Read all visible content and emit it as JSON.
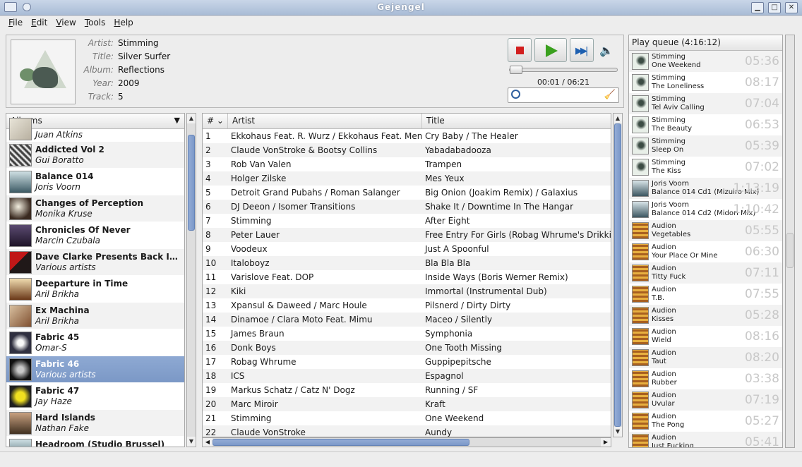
{
  "window": {
    "title": "Gejengel"
  },
  "menu": [
    "File",
    "Edit",
    "View",
    "Tools",
    "Help"
  ],
  "now_playing": {
    "labels": {
      "artist": "Artist:",
      "title": "Title:",
      "album": "Album:",
      "year": "Year:",
      "track": "Track:"
    },
    "artist": "Stimming",
    "title": "Silver Surfer",
    "album": "Reflections",
    "year": "2009",
    "track": "5",
    "time": "00:01 / 06:21",
    "progress_fraction": 0.003
  },
  "albums": {
    "header": "Albums",
    "items": [
      {
        "title": "",
        "artist": "Juan Atkins",
        "thumb": "th-drumcode",
        "partial": true
      },
      {
        "title": "Addicted Vol 2",
        "artist": "Gui Boratto",
        "thumb": "th-boratto"
      },
      {
        "title": "Balance 014",
        "artist": "Joris Voorn",
        "thumb": "th-voorn"
      },
      {
        "title": "Changes of Perception",
        "artist": "Monika Kruse",
        "thumb": "th-kruse"
      },
      {
        "title": "Chronicles Of Never",
        "artist": "Marcin Czubala",
        "thumb": "th-czubala"
      },
      {
        "title": "Dave Clarke Presents Back In T...",
        "artist": "Various artists",
        "thumb": "th-clarke"
      },
      {
        "title": "Deeparture in Time",
        "artist": "Aril Brikha",
        "thumb": "th-brikha1"
      },
      {
        "title": "Ex Machina",
        "artist": "Aril Brikha",
        "thumb": "th-brikha2"
      },
      {
        "title": "Fabric 45",
        "artist": "Omar-S",
        "thumb": "th-fab45"
      },
      {
        "title": "Fabric 46",
        "artist": "Various artists",
        "thumb": "th-fab46",
        "selected": true
      },
      {
        "title": "Fabric 47",
        "artist": "Jay Haze",
        "thumb": "th-fab47"
      },
      {
        "title": "Hard Islands",
        "artist": "Nathan Fake",
        "thumb": "th-hard"
      },
      {
        "title": "Headroom (Studio Brussel)",
        "artist": "",
        "thumb": "th-voorn"
      }
    ]
  },
  "tracks": {
    "columns": {
      "num": "#",
      "artist": "Artist",
      "title": "Title"
    },
    "rows": [
      [
        "1",
        "Ekkohaus Feat. R. Wurz / Ekkohaus Feat. Mensa",
        "Cry Baby / The Healer"
      ],
      [
        "2",
        "Claude VonStroke & Bootsy Collins",
        "Yabadabadooza"
      ],
      [
        "3",
        "Rob Van Valen",
        "Trampen"
      ],
      [
        "4",
        "Holger Zilske",
        "Mes Yeux"
      ],
      [
        "5",
        "Detroit Grand Pubahs / Roman Salanger",
        "Big Onion (Joakim Remix) / Galaxius"
      ],
      [
        "6",
        "DJ Deeon / Isomer Transitions",
        "Shake It / Downtime In The Hangar"
      ],
      [
        "7",
        "Stimming",
        "After Eight"
      ],
      [
        "8",
        "Peter Lauer",
        "Free Entry For Girls (Robag Whrume's Drikkiba"
      ],
      [
        "9",
        "Voodeux",
        "Just A Spoonful"
      ],
      [
        "10",
        "Italoboyz",
        "Bla Bla Bla"
      ],
      [
        "11",
        "Varislove Feat. DOP",
        "Inside Ways (Boris Werner Remix)"
      ],
      [
        "12",
        "Kiki",
        "Immortal (Instrumental Dub)"
      ],
      [
        "13",
        "Xpansul & Daweed / Marc Houle",
        "Pilsnerd / Dirty Dirty"
      ],
      [
        "14",
        "Dinamoe / Clara Moto Feat. Mimu",
        "Maceo / Silently"
      ],
      [
        "15",
        "James Braun",
        "Symphonia"
      ],
      [
        "16",
        "Donk Boys",
        "One Tooth Missing"
      ],
      [
        "17",
        "Robag Whrume",
        "Guppipepitsche"
      ],
      [
        "18",
        "ICS",
        "Espagnol"
      ],
      [
        "19",
        "Markus Schatz / Catz N' Dogz",
        "Running / SF"
      ],
      [
        "20",
        "Marc Miroir",
        "Kraft"
      ],
      [
        "21",
        "Stimming",
        "One Weekend"
      ],
      [
        "22",
        "Claude VonStroke",
        "Aundy"
      ]
    ]
  },
  "queue": {
    "header": "Play queue (4:16:12)",
    "items": [
      {
        "artist": "Stimming",
        "title": "One Weekend",
        "duration": "05:36",
        "thumb": "th-stim"
      },
      {
        "artist": "Stimming",
        "title": "The Loneliness",
        "duration": "08:17",
        "thumb": "th-stim"
      },
      {
        "artist": "Stimming",
        "title": "Tel Aviv Calling",
        "duration": "07:04",
        "thumb": "th-stim"
      },
      {
        "artist": "Stimming",
        "title": "The Beauty",
        "duration": "06:53",
        "thumb": "th-stim"
      },
      {
        "artist": "Stimming",
        "title": "Sleep On",
        "duration": "05:39",
        "thumb": "th-stim"
      },
      {
        "artist": "Stimming",
        "title": "The Kiss",
        "duration": "07:02",
        "thumb": "th-stim"
      },
      {
        "artist": "Joris Voorn",
        "title": "Balance 014 Cd1 (Mizuiro Mix)",
        "duration": "1:13:19",
        "thumb": "th-voornq"
      },
      {
        "artist": "Joris Voorn",
        "title": "Balance 014 Cd2 (Midori Mix)",
        "duration": "1:10:42",
        "thumb": "th-voornq"
      },
      {
        "artist": "Audion",
        "title": "Vegetables",
        "duration": "05:55",
        "thumb": "th-audion"
      },
      {
        "artist": "Audion",
        "title": "Your Place Or Mine",
        "duration": "06:30",
        "thumb": "th-audion"
      },
      {
        "artist": "Audion",
        "title": "Titty Fuck",
        "duration": "07:11",
        "thumb": "th-audion"
      },
      {
        "artist": "Audion",
        "title": "T.B.",
        "duration": "07:55",
        "thumb": "th-audion"
      },
      {
        "artist": "Audion",
        "title": "Kisses",
        "duration": "05:28",
        "thumb": "th-audion"
      },
      {
        "artist": "Audion",
        "title": "Wield",
        "duration": "08:16",
        "thumb": "th-audion"
      },
      {
        "artist": "Audion",
        "title": "Taut",
        "duration": "08:20",
        "thumb": "th-audion"
      },
      {
        "artist": "Audion",
        "title": "Rubber",
        "duration": "03:38",
        "thumb": "th-audion"
      },
      {
        "artist": "Audion",
        "title": "Uvular",
        "duration": "07:19",
        "thumb": "th-audion"
      },
      {
        "artist": "Audion",
        "title": "The Pong",
        "duration": "05:27",
        "thumb": "th-audion"
      },
      {
        "artist": "Audion",
        "title": "Just Fucking",
        "duration": "05:41",
        "thumb": "th-audion"
      }
    ]
  }
}
